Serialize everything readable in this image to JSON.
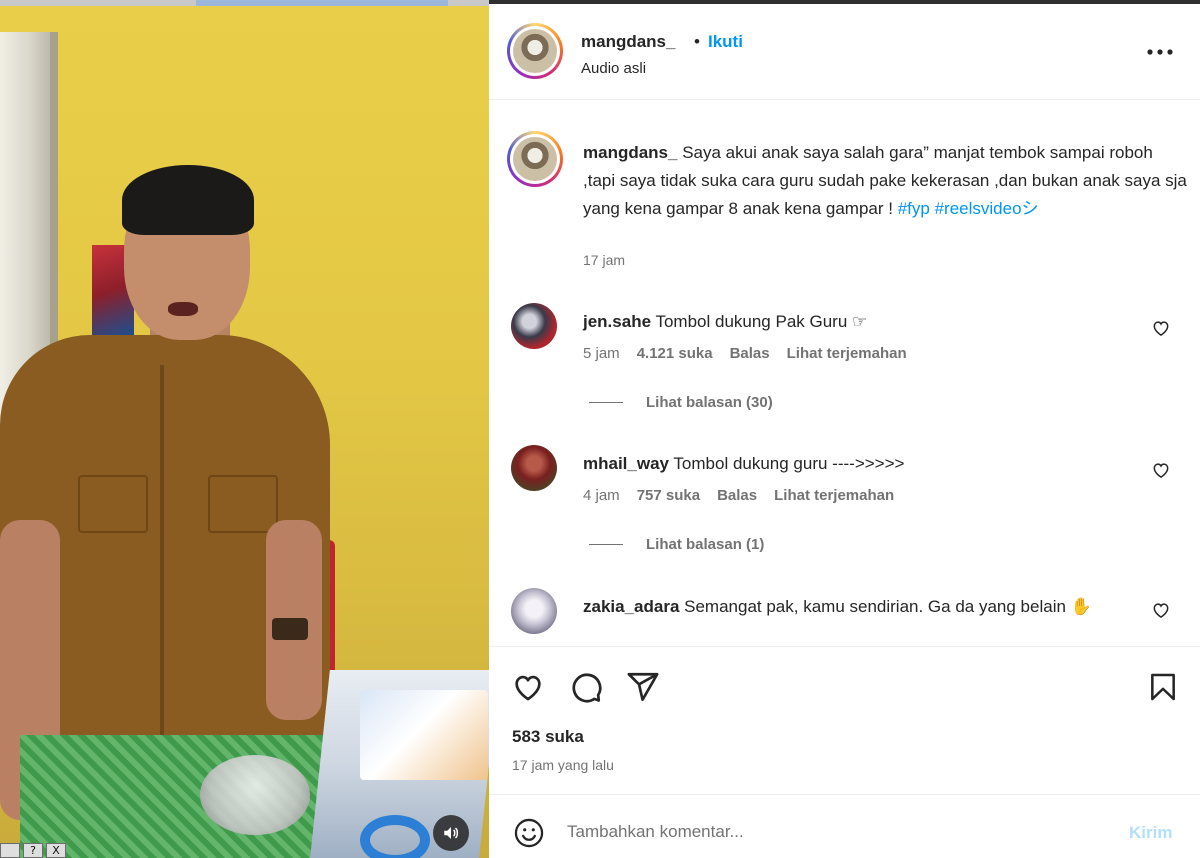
{
  "video": {
    "sound_icon": "speaker-icon",
    "window_buttons": [
      "",
      "?",
      "X"
    ]
  },
  "post": {
    "username": "mangdans_",
    "separator": "•",
    "follow_label": "Ikuti",
    "audio_label": "Audio asli",
    "more_icon": "more-horizontal-icon"
  },
  "caption": {
    "username": "mangdans_",
    "text": " Saya akui anak saya salah gara” manjat tembok sampai roboh ,tapi saya tidak suka cara guru sudah pake kekerasan ,dan bukan anak saya sja yang kena gampar 8 anak kena gampar ! ",
    "tag1": "#fyp",
    "tag2": "#reelsvideoシ",
    "time": "17 jam"
  },
  "comments": [
    {
      "username": "jen.sahe",
      "text": " Tombol dukung Pak Guru ☞",
      "time": "5 jam",
      "likes": "4.121 suka",
      "reply": "Balas",
      "translate": "Lihat terjemahan",
      "replies_label": "Lihat balasan (30)",
      "avatar_color": "#3a3a4a"
    },
    {
      "username": "mhail_way",
      "text": " Tombol dukung guru ---->>>>>",
      "time": "4 jam",
      "likes": "757 suka",
      "reply": "Balas",
      "translate": "Lihat terjemahan",
      "replies_label": "Lihat balasan (1)",
      "avatar_color": "#7a1f1f"
    },
    {
      "username": "zakia_adara",
      "text": " Semangat pak, kamu sendirian. Ga da yang belain ✋",
      "avatar_color": "#c9c6d6"
    }
  ],
  "actions": {
    "like_icon": "heart-icon",
    "comment_icon": "comment-icon",
    "share_icon": "share-icon",
    "save_icon": "bookmark-icon",
    "likes": "583 suka",
    "time_ago": "17 jam yang lalu"
  },
  "add_comment": {
    "emoji_icon": "emoji-icon",
    "placeholder": "Tambahkan komentar...",
    "post_label": "Kirim"
  },
  "colors": {
    "accent": "#0095f6",
    "post_disabled": "#b2dffc",
    "muted": "#737373",
    "text": "#262626"
  }
}
